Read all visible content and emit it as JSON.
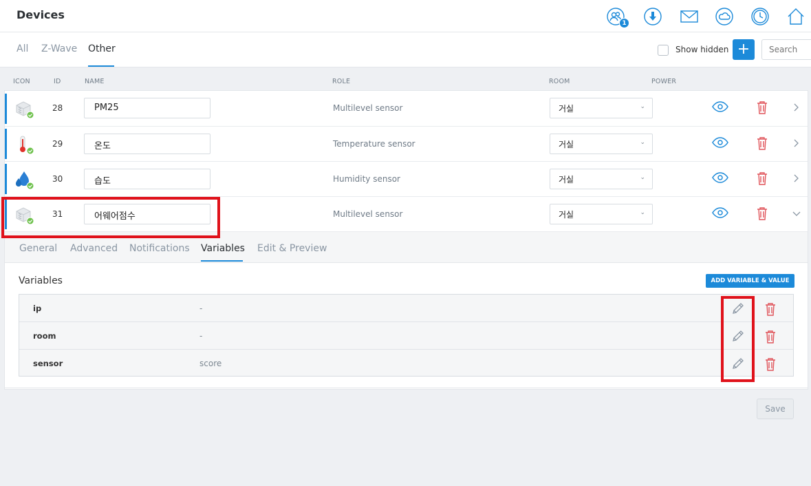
{
  "header": {
    "title": "Devices",
    "notification_count": "1",
    "icons": [
      "users-icon",
      "download-icon",
      "mail-icon",
      "cloud-icon",
      "clock-icon",
      "home-icon"
    ]
  },
  "tabs": {
    "all": "All",
    "zwave": "Z-Wave",
    "other": "Other"
  },
  "toolbar": {
    "show_hidden": "Show hidden",
    "add": "+",
    "search_placeholder": "Search"
  },
  "columns": {
    "icon": "ICON",
    "id": "ID",
    "name": "NAME",
    "role": "ROLE",
    "room": "ROOM",
    "power": "POWER"
  },
  "devices": [
    {
      "icon": "multilevel-sensor-icon",
      "id": "28",
      "name": "PM25",
      "role": "Multilevel sensor",
      "room": "거실"
    },
    {
      "icon": "temperature-icon",
      "id": "29",
      "name": "온도",
      "role": "Temperature sensor",
      "room": "거실"
    },
    {
      "icon": "humidity-icon",
      "id": "30",
      "name": "습도",
      "role": "Humidity sensor",
      "room": "거실"
    },
    {
      "icon": "multilevel-sensor-icon",
      "id": "31",
      "name": "어웨어점수",
      "role": "Multilevel sensor",
      "room": "거실"
    }
  ],
  "panel": {
    "tabs": {
      "general": "General",
      "advanced": "Advanced",
      "notifications": "Notifications",
      "variables": "Variables",
      "edit_preview": "Edit & Preview"
    },
    "variables_title": "Variables",
    "add_variable": "ADD VARIABLE & VALUE",
    "variables": [
      {
        "key": "ip",
        "value": "-"
      },
      {
        "key": "room",
        "value": "-"
      },
      {
        "key": "sensor",
        "value": "score"
      }
    ],
    "save": "Save"
  },
  "colors": {
    "accent": "#1c8ad9",
    "danger": "#e0545a",
    "highlight": "#e0121b"
  }
}
